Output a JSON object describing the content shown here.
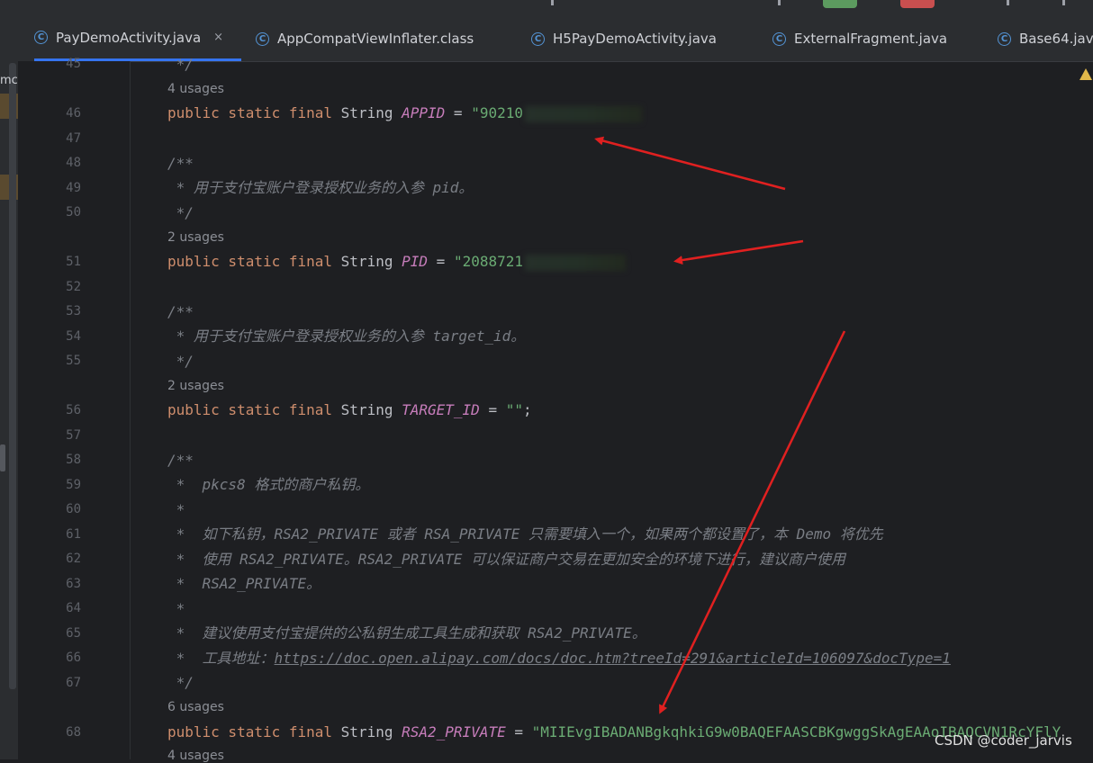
{
  "sidebar": {
    "fragment": "mc"
  },
  "tabs": [
    {
      "label": "PayDemoActivity.java",
      "active": true,
      "close": "×"
    },
    {
      "label": "AppCompatViewInflater.class"
    },
    {
      "label": "H5PayDemoActivity.java"
    },
    {
      "label": "ExternalFragment.java"
    },
    {
      "label": "Base64.java"
    }
  ],
  "tab_icon_letter": "C",
  "editor": {
    "lines": [
      {
        "num": "45",
        "code": " */"
      },
      {
        "usages": "4 usages"
      },
      {
        "num": "46",
        "kw": "public static final",
        "type": "String",
        "field": "APPID",
        "eq": "=",
        "str": "\"90210",
        "redacted": true
      },
      {
        "num": "47"
      },
      {
        "num": "48",
        "code": "/**"
      },
      {
        "num": "49",
        "code": " * 用于支付宝账户登录授权业务的入参 pid。"
      },
      {
        "num": "50",
        "code": " */"
      },
      {
        "usages": "2 usages"
      },
      {
        "num": "51",
        "kw": "public static final",
        "type": "String",
        "field": "PID",
        "eq": "=",
        "str": "\"2088721",
        "redacted": true
      },
      {
        "num": "52"
      },
      {
        "num": "53",
        "code": "/**"
      },
      {
        "num": "54",
        "code": " * 用于支付宝账户登录授权业务的入参 target_id。"
      },
      {
        "num": "55",
        "code": " */"
      },
      {
        "usages": "2 usages"
      },
      {
        "num": "56",
        "kw": "public static final",
        "type": "String",
        "field": "TARGET_ID",
        "eq": "=",
        "str": "\"\"",
        "tail": ";"
      },
      {
        "num": "57"
      },
      {
        "num": "58",
        "code": "/**"
      },
      {
        "num": "59",
        "code": " *  pkcs8 格式的商户私钥。"
      },
      {
        "num": "60",
        "code": " *"
      },
      {
        "num": "61",
        "code": " *  如下私钥，RSA2_PRIVATE 或者 RSA_PRIVATE 只需要填入一个，如果两个都设置了，本 Demo 将优先"
      },
      {
        "num": "62",
        "code": " *  使用 RSA2_PRIVATE。RSA2_PRIVATE 可以保证商户交易在更加安全的环境下进行，建议商户使用"
      },
      {
        "num": "63",
        "code": " *  RSA2_PRIVATE。"
      },
      {
        "num": "64",
        "code": " *"
      },
      {
        "num": "65",
        "code": " *  建议使用支付宝提供的公私钥生成工具生成和获取 RSA2_PRIVATE。"
      },
      {
        "num": "66",
        "code": " *  工具地址：",
        "link": "https://doc.open.alipay.com/docs/doc.htm?treeId=291&articleId=106097&docType=1"
      },
      {
        "num": "67",
        "code": " */"
      },
      {
        "usages": "6 usages"
      },
      {
        "num": "68",
        "kw": "public static final",
        "type": "String",
        "field": "RSA2_PRIVATE",
        "eq": "=",
        "str": "\"MIIEvgIBADANBgkqhkiG9w0BAQEFAASCBKgwggSkAgEAAoIBAQCVN1RcYFlY"
      },
      {
        "usages": "4 usages"
      }
    ]
  },
  "watermark": "CSDN @coder_jarvis",
  "colors": {
    "background": "#1e1f22",
    "keyword": "#cf8e6d",
    "field": "#c77dbb",
    "string": "#6aab73",
    "comment": "#7a7e85",
    "arrow": "#e02020",
    "tab_active": "#3574f0"
  }
}
